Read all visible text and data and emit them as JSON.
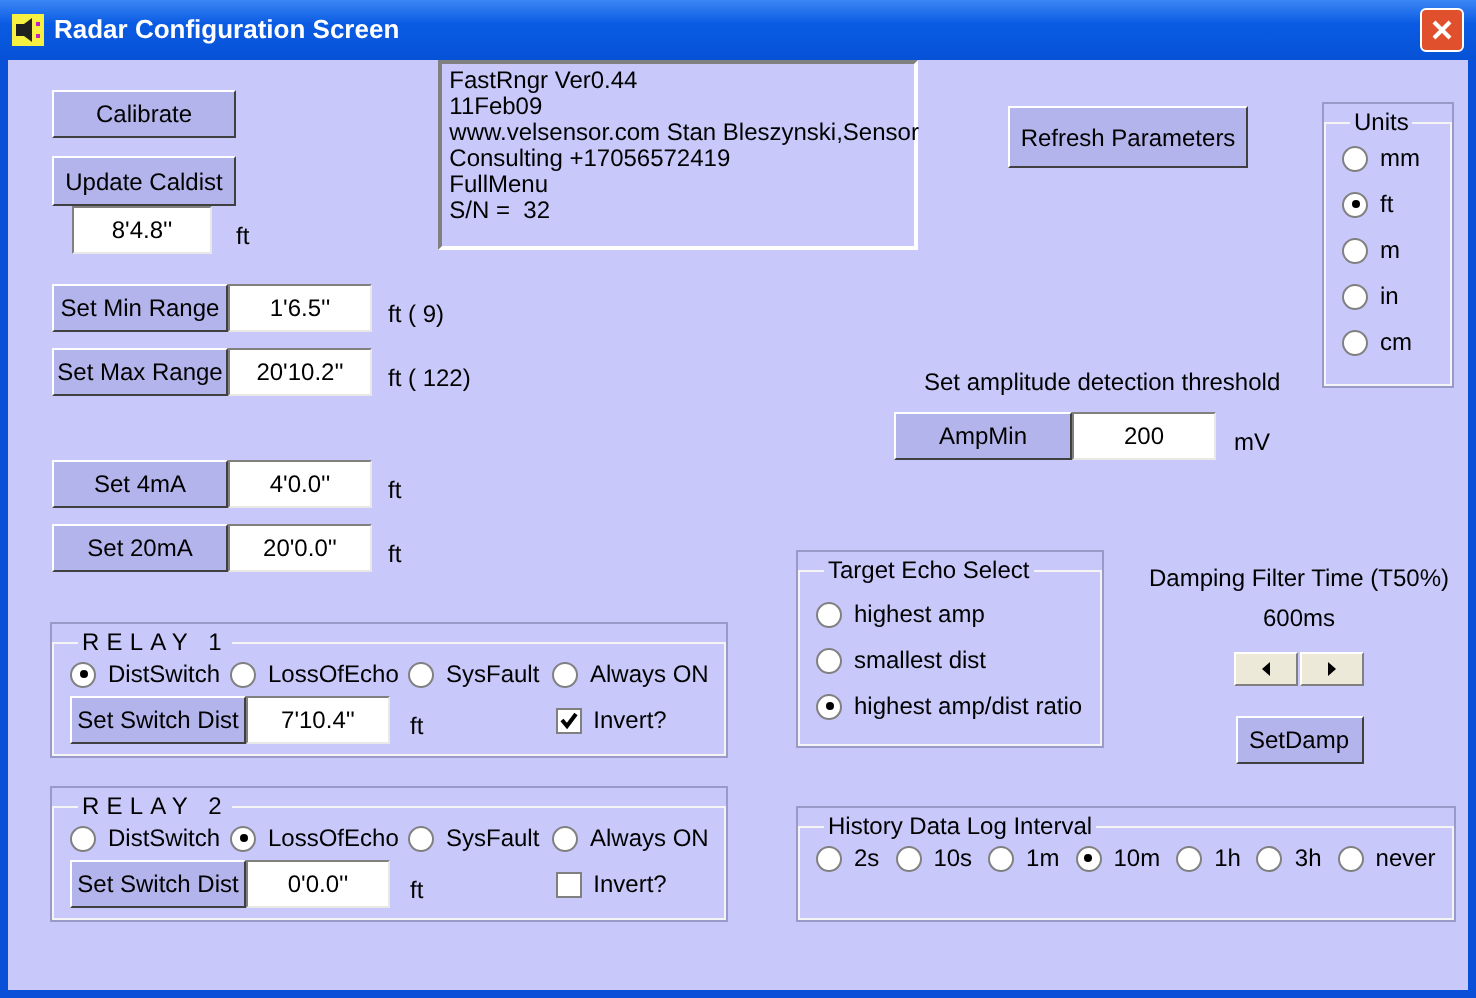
{
  "window": {
    "title": "Radar Configuration Screen"
  },
  "calibrate_button": "Calibrate",
  "caldist": {
    "button": "Update Caldist",
    "value": "8'4.8''",
    "unit": "ft"
  },
  "info_text": [
    "FastRngr Ver0.44",
    "11Feb09",
    "www.velsensor.com Stan Bleszynski,Sensor",
    "Consulting +17056572419",
    "FullMenu",
    "S/N =  32"
  ],
  "range_settings": [
    {
      "button": "Set Min Range",
      "value": "1'6.5''",
      "unit": "ft ( 9)"
    },
    {
      "button": "Set Max Range",
      "value": "20'10.2''",
      "unit": "ft ( 122)"
    }
  ],
  "refresh_button": "Refresh Parameters",
  "amplitude": {
    "label": "Set amplitude detection threshold",
    "button": "AmpMin",
    "value": "200",
    "unit": "mV"
  },
  "units": {
    "title": "Units",
    "options": [
      {
        "label": "mm",
        "selected": false
      },
      {
        "label": "ft",
        "selected": true
      },
      {
        "label": "m",
        "selected": false
      },
      {
        "label": "in",
        "selected": false
      },
      {
        "label": "cm",
        "selected": false
      }
    ]
  },
  "current_settings": [
    {
      "button": "Set 4mA",
      "value": "4'0.0''",
      "unit": "ft"
    },
    {
      "button": "Set 20mA",
      "value": "20'0.0''",
      "unit": "ft"
    }
  ],
  "relays": [
    {
      "title": "RELAY 1",
      "modes": [
        {
          "label": "DistSwitch",
          "selected": true
        },
        {
          "label": "LossOfEcho",
          "selected": false
        },
        {
          "label": "SysFault",
          "selected": false
        },
        {
          "label": "Always ON",
          "selected": false
        }
      ],
      "button": "Set Switch Dist",
      "value": "7'10.4''",
      "unit": "ft",
      "invert": {
        "label": "Invert?",
        "checked": true
      }
    },
    {
      "title": "RELAY 2",
      "modes": [
        {
          "label": "DistSwitch",
          "selected": false
        },
        {
          "label": "LossOfEcho",
          "selected": true
        },
        {
          "label": "SysFault",
          "selected": false
        },
        {
          "label": "Always ON",
          "selected": false
        }
      ],
      "button": "Set Switch Dist",
      "value": "0'0.0''",
      "unit": "ft",
      "invert": {
        "label": "Invert?",
        "checked": false
      }
    }
  ],
  "target_echo": {
    "title": "Target Echo Select",
    "options": [
      {
        "label": "highest amp",
        "selected": false
      },
      {
        "label": "smallest dist",
        "selected": false
      },
      {
        "label": "highest amp/dist ratio",
        "selected": true
      }
    ]
  },
  "damping": {
    "label": "Damping Filter Time (T50%)",
    "value": "600ms",
    "button": "SetDamp"
  },
  "history": {
    "title": "History Data Log Interval",
    "options": [
      {
        "label": "2s",
        "selected": false
      },
      {
        "label": "10s",
        "selected": false
      },
      {
        "label": "1m",
        "selected": false
      },
      {
        "label": "10m",
        "selected": true
      },
      {
        "label": "1h",
        "selected": false
      },
      {
        "label": "3h",
        "selected": false
      },
      {
        "label": "never",
        "selected": false
      }
    ]
  }
}
